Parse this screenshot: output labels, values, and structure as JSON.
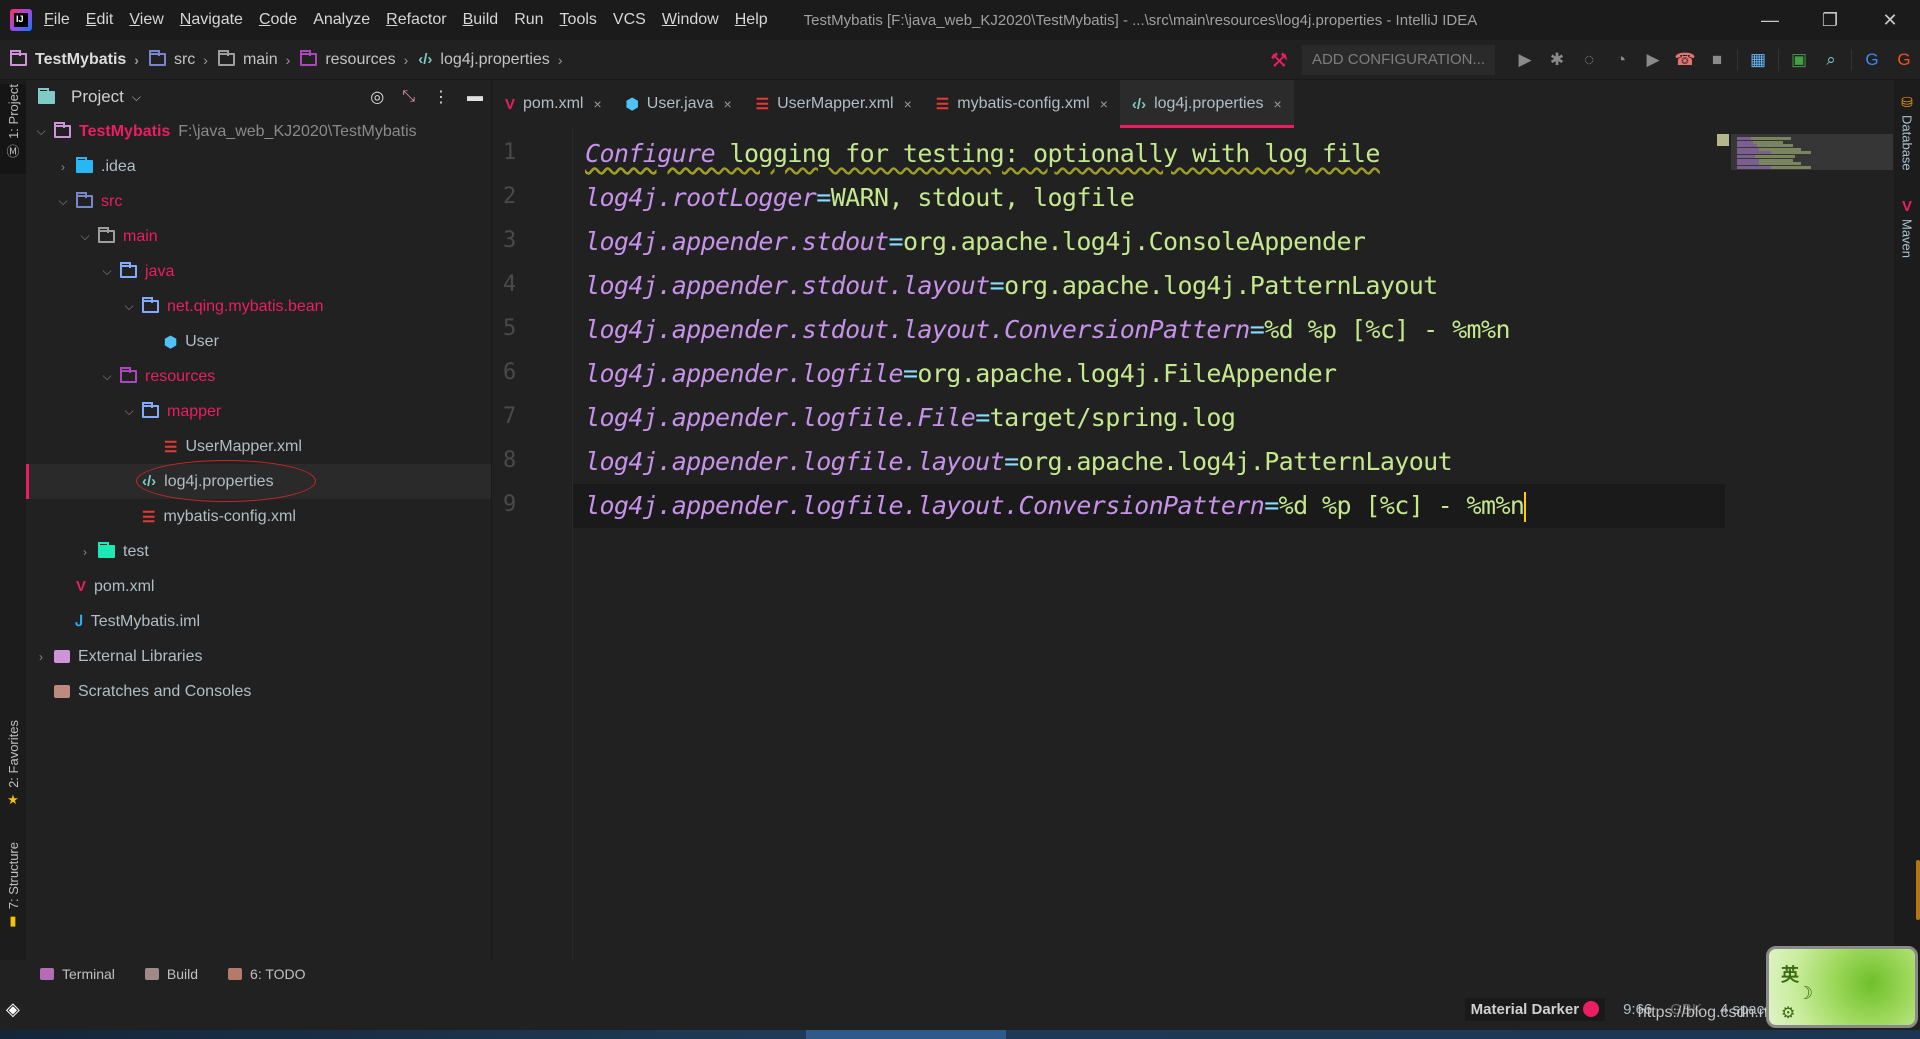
{
  "window": {
    "title": "TestMybatis [F:\\java_web_KJ2020\\TestMybatis] - ...\\src\\main\\resources\\log4j.properties - IntelliJ IDEA",
    "controls": {
      "minimize": "—",
      "restore": "❐",
      "close": "✕"
    }
  },
  "menu": [
    {
      "label": "File",
      "mnemonic": "F",
      "rest": "ile"
    },
    {
      "label": "Edit",
      "mnemonic": "E",
      "rest": "dit"
    },
    {
      "label": "View",
      "mnemonic": "V",
      "rest": "iew"
    },
    {
      "label": "Navigate",
      "mnemonic": "N",
      "rest": "avigate"
    },
    {
      "label": "Code",
      "mnemonic": "C",
      "rest": "ode"
    },
    {
      "label": "Analyze",
      "mnemonic": "",
      "rest": "Analyze"
    },
    {
      "label": "Refactor",
      "mnemonic": "R",
      "rest": "efactor"
    },
    {
      "label": "Build",
      "mnemonic": "B",
      "rest": "uild"
    },
    {
      "label": "Run",
      "mnemonic": "",
      "rest": "Run"
    },
    {
      "label": "Tools",
      "mnemonic": "T",
      "rest": "ools"
    },
    {
      "label": "VCS",
      "mnemonic": "",
      "rest": "VCS"
    },
    {
      "label": "Window",
      "mnemonic": "W",
      "rest": "indow"
    },
    {
      "label": "Help",
      "mnemonic": "H",
      "rest": "elp"
    }
  ],
  "breadcrumb": [
    {
      "label": "TestMybatis",
      "icon": "project-folder-icon"
    },
    {
      "label": "src",
      "icon": "source-folder-icon"
    },
    {
      "label": "main",
      "icon": "folder-icon"
    },
    {
      "label": "resources",
      "icon": "resources-folder-icon"
    },
    {
      "label": "log4j.properties",
      "icon": "properties-file-icon"
    }
  ],
  "toolbar": {
    "add_configuration": "ADD CONFIGURATION...",
    "icons": [
      "run-icon",
      "debug-icon",
      "coverage-icon",
      "profiler-icon",
      "run-alt-icon",
      "attach-icon",
      "stop-icon",
      "project-structure-icon",
      "terminal-icon",
      "search-icon",
      "translate-icon",
      "translate-alt-icon"
    ]
  },
  "left_strip": {
    "project": "1: Project",
    "favorites": "2: Favorites",
    "structure": "7: Structure"
  },
  "right_strip": {
    "database": "Database",
    "maven": "Maven"
  },
  "project_panel": {
    "title": "Project",
    "tree": [
      {
        "label": "TestMybatis",
        "path": "F:\\java_web_KJ2020\\TestMybatis",
        "depth": 0,
        "arrow": "down",
        "red": true,
        "bold": true,
        "icon": "project-folder"
      },
      {
        "label": ".idea",
        "depth": 1,
        "arrow": "right",
        "icon": "idea-folder"
      },
      {
        "label": "src",
        "depth": 1,
        "arrow": "down",
        "red": true,
        "icon": "src-folder"
      },
      {
        "label": "main",
        "depth": 2,
        "arrow": "down",
        "red": true,
        "icon": "folder"
      },
      {
        "label": "java",
        "depth": 3,
        "arrow": "down",
        "red": true,
        "icon": "java-folder"
      },
      {
        "label": "net.qing.mybatis.bean",
        "depth": 4,
        "arrow": "down",
        "red": true,
        "icon": "package-folder"
      },
      {
        "label": "User",
        "depth": 5,
        "arrow": "none",
        "icon": "class"
      },
      {
        "label": "resources",
        "depth": 3,
        "arrow": "down",
        "red": true,
        "icon": "resources-folder"
      },
      {
        "label": "mapper",
        "depth": 4,
        "arrow": "down",
        "red": true,
        "icon": "package-folder"
      },
      {
        "label": "UserMapper.xml",
        "depth": 5,
        "arrow": "none",
        "icon": "xml"
      },
      {
        "label": "log4j.properties",
        "depth": 4,
        "arrow": "none",
        "icon": "properties",
        "selected": true
      },
      {
        "label": "mybatis-config.xml",
        "depth": 4,
        "arrow": "none",
        "icon": "xml"
      },
      {
        "label": "test",
        "depth": 2,
        "arrow": "right",
        "icon": "test-folder"
      },
      {
        "label": "pom.xml",
        "depth": 1,
        "arrow": "none",
        "icon": "maven"
      },
      {
        "label": "TestMybatis.iml",
        "depth": 1,
        "arrow": "none",
        "icon": "iml"
      },
      {
        "label": "External Libraries",
        "depth": 0,
        "arrow": "right",
        "icon": "library"
      },
      {
        "label": "Scratches and Consoles",
        "depth": 0,
        "arrow": "none",
        "icon": "scratches"
      }
    ]
  },
  "tabs": [
    {
      "label": "pom.xml",
      "icon": "maven",
      "active": false
    },
    {
      "label": "User.java",
      "icon": "class",
      "active": false
    },
    {
      "label": "UserMapper.xml",
      "icon": "xml",
      "active": false
    },
    {
      "label": "mybatis-config.xml",
      "icon": "xml",
      "active": false
    },
    {
      "label": "log4j.properties",
      "icon": "properties",
      "active": true
    }
  ],
  "editor": {
    "lines": [
      {
        "n": "1",
        "type": "comment",
        "key": "Configure",
        "rest": " logging for testing: optionally with log file"
      },
      {
        "n": "2",
        "key": "log4j.rootLogger",
        "value": "WARN, stdout, logfile"
      },
      {
        "n": "3",
        "key": "log4j.appender.stdout",
        "value": "org.apache.log4j.ConsoleAppender"
      },
      {
        "n": "4",
        "key": "log4j.appender.stdout.layout",
        "value": "org.apache.log4j.PatternLayout"
      },
      {
        "n": "5",
        "key": "log4j.appender.stdout.layout.ConversionPattern",
        "value": "%d %p [%c] - %m%n"
      },
      {
        "n": "6",
        "key": "log4j.appender.logfile",
        "value": "org.apache.log4j.FileAppender"
      },
      {
        "n": "7",
        "key": "log4j.appender.logfile.File",
        "value": "target/spring.log"
      },
      {
        "n": "8",
        "key": "log4j.appender.logfile.layout",
        "value": "org.apache.log4j.PatternLayout"
      },
      {
        "n": "9",
        "key": "log4j.appender.logfile.layout.ConversionPattern",
        "value": "%d %p [%c] - %m%n",
        "current": true
      }
    ]
  },
  "bottom_tools": [
    {
      "label": "Terminal",
      "icon": "terminal-icon",
      "color": "#b36cb5"
    },
    {
      "label": "Build",
      "icon": "build-icon",
      "color": "#9e8a86"
    },
    {
      "label": "6: TODO",
      "icon": "todo-icon",
      "color": "#b57a6a"
    }
  ],
  "statusbar": {
    "theme": "Material Darker",
    "position": "9:66",
    "encoding": "GBK",
    "indent": "4 spaces"
  },
  "ime": {
    "lang": "英",
    "moon": "☽",
    "gear": "⚙"
  },
  "watermark": "https://blog.csdn.net/weixin_44202489",
  "colors": {
    "accent": "#e91e63",
    "key": "#c792ea",
    "value": "#c3e88d",
    "operator": "#89ddff",
    "caret": "#ffcc00"
  }
}
